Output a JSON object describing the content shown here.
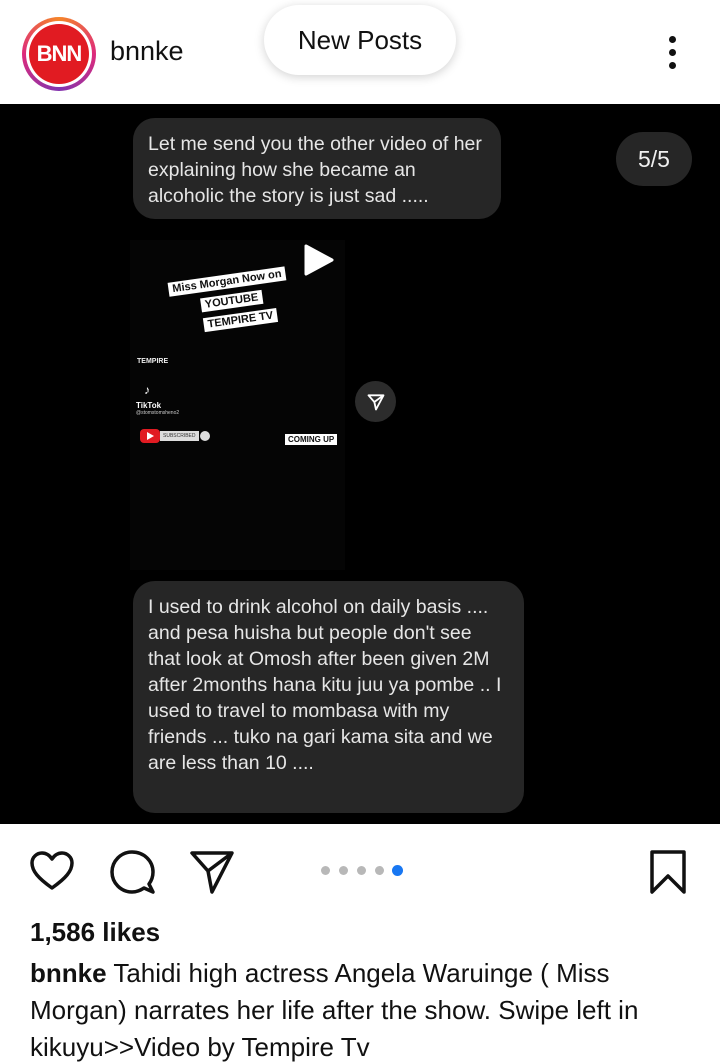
{
  "header": {
    "avatar_text": "BNN",
    "username": "bnnke",
    "new_posts_label": "New Posts",
    "more_icon": "more-vertical-icon"
  },
  "media": {
    "counter": "5/5",
    "message_top": "Let me send you  the other video of her explaining how she became an alcoholic  the story  is just sad .....",
    "video": {
      "sticker_lines": [
        "Miss Morgan Now on",
        "YOUTUBE",
        "TEMPIRE TV"
      ],
      "brand": "TEMPIRE",
      "tiktok_label": "TikTok",
      "tiktok_handle": "@stomstomsheno2",
      "subscribe_label": "SUBSCRIBED",
      "coming_up": "COMING UP"
    },
    "message_bottom": "I used to drink alcohol on daily basis .... and pesa huisha but people don't see that look at Omosh after been given 2M after 2months hana kitu juu ya pombe ..  I used to travel to mombasa  with my friends   ... tuko na gari kama sita and we are less than 10 ...."
  },
  "actions": {
    "icons": [
      "heart-icon",
      "comment-icon",
      "share-icon",
      "bookmark-icon"
    ],
    "carousel_total": 5,
    "carousel_active": 5,
    "active_color": "#1877f2"
  },
  "post": {
    "likes": "1,586 likes",
    "caption_user": "bnnke",
    "caption_text": "Tahidi high actress Angela Waruinge ( Miss Morgan)  narrates her life after the show. Swipe left in kikuyu>>Video by  Tempire Tv"
  }
}
